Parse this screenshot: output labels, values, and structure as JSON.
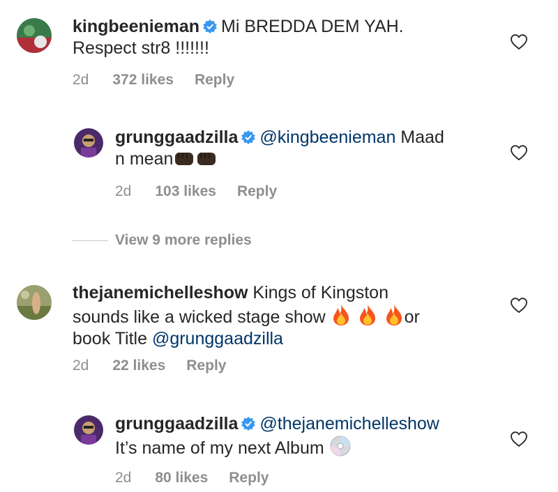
{
  "comments": [
    {
      "username": "kingbeenieman",
      "text_line1": "Mi BREDDA DEM YAH.",
      "text_line2": "Respect str8 !!!!!!!",
      "time": "2d",
      "likes": "372 likes",
      "reply_label": "Reply"
    },
    {
      "username": "grunggaadzilla",
      "mention": "@kingbeenieman",
      "text_after_mention": " Maad",
      "text_line2": "n mean",
      "emojis": "fist-emoji fist-emoji",
      "time": "2d",
      "likes": "103 likes",
      "reply_label": "Reply"
    },
    {
      "username": "thejanemichelleshow",
      "text_line1": " Kings of Kingston",
      "text_line2": "sounds like a wicked stage  show",
      "emojis": "fire-emoji fire-emoji fire-emoji",
      "text_after_emojis": "or",
      "text_line3_prefix": "book Title ",
      "mention": "@grunggaadzilla",
      "time": "2d",
      "likes": "22 likes",
      "reply_label": "Reply"
    },
    {
      "username": "grunggaadzilla",
      "mention": "@thejanemichelleshow",
      "text_line2": "It’s name of my next Album",
      "emojis": "cd-emoji",
      "time": "2d",
      "likes": "80 likes",
      "reply_label": "Reply"
    }
  ],
  "view_more": "View 9 more replies",
  "colors": {
    "text": "#262626",
    "muted": "#8e8e8e",
    "mention": "#003569",
    "verified": "#3897f0"
  }
}
